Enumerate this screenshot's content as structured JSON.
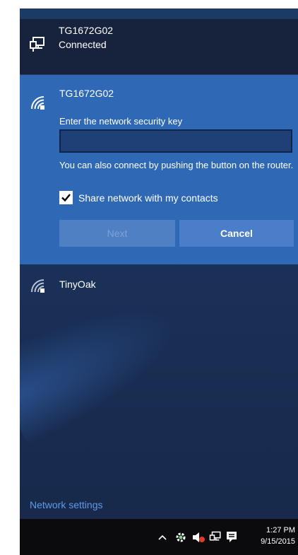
{
  "connected_network": {
    "name": "TG1672G02",
    "status": "Connected",
    "icon": "ethernet-monitor-icon"
  },
  "selected_network": {
    "name": "TG1672G02",
    "icon": "wifi-secured-icon",
    "prompt": "Enter the network security key",
    "key_value": "",
    "key_placeholder": "",
    "hint": "You can also connect by pushing the button on the router.",
    "share_label": "Share network with my contacts",
    "share_checked": true,
    "next_label": "Next",
    "cancel_label": "Cancel"
  },
  "other_networks": [
    {
      "name": "TinyOak",
      "icon": "wifi-secured-icon"
    }
  ],
  "network_settings_label": "Network settings",
  "taskbar": {
    "time": "1:27 PM",
    "date": "9/15/2015",
    "tray_icons": [
      "chevron-up-icon",
      "settings-gear-icon",
      "volume-muted-icon",
      "network-icon",
      "action-center-icon"
    ]
  },
  "colors": {
    "panel_bg": "#1b335c",
    "selected_bg": "#2f68b4",
    "link": "#5e9ae6",
    "taskbar_bg": "#0b0b0d"
  }
}
